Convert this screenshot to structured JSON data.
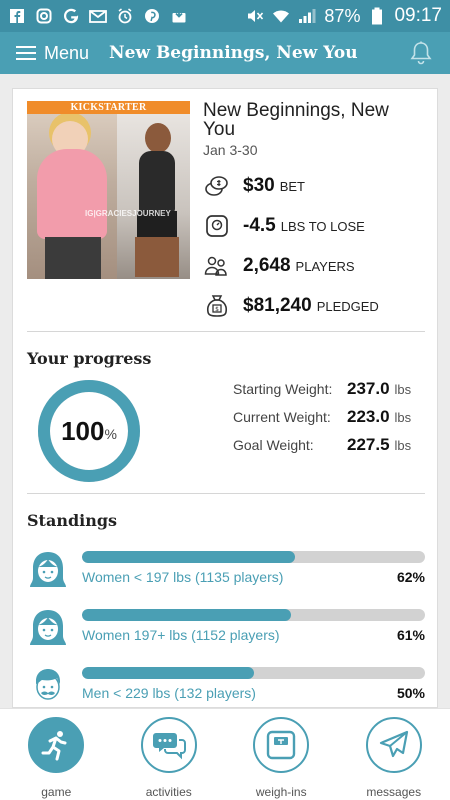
{
  "status_bar": {
    "battery": "87%",
    "time": "09:17",
    "icons": [
      "facebook-icon",
      "instagram-icon",
      "google-icon",
      "email-icon",
      "alarm-icon",
      "pinterest-icon",
      "download-icon",
      "mute-icon",
      "wifi-icon",
      "signal-icon",
      "battery-icon"
    ]
  },
  "app_bar": {
    "menu_label": "Menu",
    "title": "New Beginnings, New You"
  },
  "challenge": {
    "banner": "KICKSTARTER",
    "watermark": "IG|GRACIESJOURNEY",
    "title": "New Beginnings, New You",
    "dates": "Jan 3-30",
    "stats": [
      {
        "value": "$30",
        "unit": "BET",
        "icon": "coins-icon"
      },
      {
        "value": "-4.5",
        "unit": "LBS TO LOSE",
        "icon": "scale-icon"
      },
      {
        "value": "2,648",
        "unit": "PLAYERS",
        "icon": "players-icon"
      },
      {
        "value": "$81,240",
        "unit": "PLEDGED",
        "icon": "money-bag-icon"
      }
    ]
  },
  "progress": {
    "heading": "Your progress",
    "percent_value": "100",
    "percent_fraction": 1.0,
    "percent_symbol": "%",
    "weights": [
      {
        "label": "Starting Weight:",
        "value": "237.0",
        "unit": "lbs"
      },
      {
        "label": "Current Weight:",
        "value": "223.0",
        "unit": "lbs"
      },
      {
        "label": "Goal Weight:",
        "value": "227.5",
        "unit": "lbs"
      }
    ]
  },
  "standings": {
    "heading": "Standings",
    "rows": [
      {
        "label": "Women < 197 lbs (1135 players)",
        "percent": "62%",
        "fraction": 0.62,
        "avatar": "woman-avatar-icon"
      },
      {
        "label": "Women 197+ lbs (1152 players)",
        "percent": "61%",
        "fraction": 0.61,
        "avatar": "woman-avatar-icon"
      },
      {
        "label": "Men < 229 lbs (132 players)",
        "percent": "50%",
        "fraction": 0.5,
        "avatar": "man-avatar-icon"
      }
    ]
  },
  "bottom_nav": {
    "items": [
      {
        "label": "game",
        "icon": "runner-icon",
        "active": true
      },
      {
        "label": "activities",
        "icon": "chat-bubbles-icon",
        "active": false
      },
      {
        "label": "weigh-ins",
        "icon": "scale-icon",
        "active": false
      },
      {
        "label": "messages",
        "icon": "paper-plane-icon",
        "active": false
      }
    ]
  },
  "colors": {
    "accent": "#4a9fb4",
    "status_bar": "#3e8fa5",
    "banner": "#f08c2a",
    "bar_track": "#d2d2d2"
  }
}
